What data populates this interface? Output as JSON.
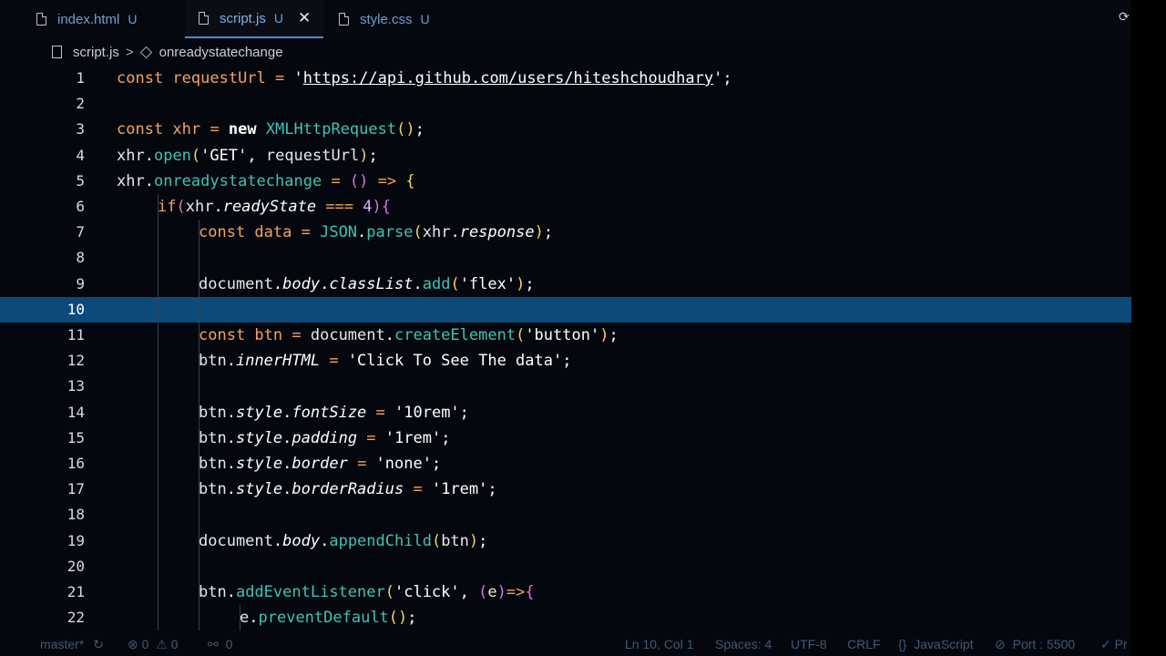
{
  "tabs": [
    {
      "label": "index.html",
      "status": "U",
      "active": false
    },
    {
      "label": "script.js",
      "status": "U",
      "active": true,
      "close": "✕"
    },
    {
      "label": "style.css",
      "status": "U",
      "active": false
    }
  ],
  "breadcrumb": {
    "file": "script.js",
    "separator": ">",
    "symbol": "onreadystatechange"
  },
  "editor": {
    "current_line": 10,
    "lines": [
      {
        "n": "1",
        "tokens": [
          [
            "kw",
            "const "
          ],
          [
            "var",
            "requestUrl"
          ],
          [
            "op",
            " = "
          ],
          [
            "str",
            "'"
          ],
          [
            "url",
            "https://api.github.com/users/hiteshchoudhary"
          ],
          [
            "str",
            "'"
          ],
          [
            "pn",
            ";"
          ]
        ]
      },
      {
        "n": "2",
        "tokens": []
      },
      {
        "n": "3",
        "tokens": [
          [
            "kw",
            "const "
          ],
          [
            "var",
            "xhr"
          ],
          [
            "op",
            " = "
          ],
          [
            "kw2",
            "new "
          ],
          [
            "cls",
            "XMLHttpRequest"
          ],
          [
            "par",
            "()"
          ],
          [
            "pn",
            ";"
          ]
        ]
      },
      {
        "n": "4",
        "tokens": [
          [
            "obj",
            "xhr"
          ],
          [
            "pn",
            "."
          ],
          [
            "fn",
            "open"
          ],
          [
            "par",
            "("
          ],
          [
            "str",
            "'GET'"
          ],
          [
            "pn",
            ", "
          ],
          [
            "obj",
            "requestUrl"
          ],
          [
            "par",
            ")"
          ],
          [
            "pn",
            ";"
          ]
        ]
      },
      {
        "n": "5",
        "tokens": [
          [
            "obj",
            "xhr"
          ],
          [
            "pn",
            "."
          ],
          [
            "fn",
            "onreadystatechange"
          ],
          [
            "op",
            " = "
          ],
          [
            "par2",
            "() "
          ],
          [
            "op",
            "=> "
          ],
          [
            "par",
            "{"
          ]
        ]
      },
      {
        "n": "6",
        "tokens": [
          [
            "kw",
            "if"
          ],
          [
            "par2",
            "("
          ],
          [
            "obj",
            "xhr"
          ],
          [
            "pn",
            "."
          ],
          [
            "prop",
            "readyState"
          ],
          [
            "op",
            " === "
          ],
          [
            "num",
            "4"
          ],
          [
            "par2",
            ")"
          ],
          [
            "par2",
            "{"
          ]
        ]
      },
      {
        "n": "7",
        "tokens": [
          [
            "kw",
            "const "
          ],
          [
            "var",
            "data"
          ],
          [
            "op",
            " = "
          ],
          [
            "cls",
            "JSON"
          ],
          [
            "pn",
            "."
          ],
          [
            "fn",
            "parse"
          ],
          [
            "par",
            "("
          ],
          [
            "obj",
            "xhr"
          ],
          [
            "pn",
            "."
          ],
          [
            "prop",
            "response"
          ],
          [
            "par",
            ")"
          ],
          [
            "pn",
            ";"
          ]
        ]
      },
      {
        "n": "8",
        "tokens": []
      },
      {
        "n": "9",
        "tokens": [
          [
            "obj",
            "document"
          ],
          [
            "pn",
            "."
          ],
          [
            "prop",
            "body"
          ],
          [
            "pn",
            "."
          ],
          [
            "prop",
            "classList"
          ],
          [
            "pn",
            "."
          ],
          [
            "fn",
            "add"
          ],
          [
            "par",
            "("
          ],
          [
            "str",
            "'flex'"
          ],
          [
            "par",
            ")"
          ],
          [
            "pn",
            ";"
          ]
        ]
      },
      {
        "n": "10",
        "tokens": []
      },
      {
        "n": "11",
        "tokens": [
          [
            "kw",
            "const "
          ],
          [
            "var",
            "btn"
          ],
          [
            "op",
            " = "
          ],
          [
            "obj",
            "document"
          ],
          [
            "pn",
            "."
          ],
          [
            "fn",
            "createElement"
          ],
          [
            "par",
            "("
          ],
          [
            "str",
            "'button'"
          ],
          [
            "par",
            ")"
          ],
          [
            "pn",
            ";"
          ]
        ]
      },
      {
        "n": "12",
        "tokens": [
          [
            "obj",
            "btn"
          ],
          [
            "pn",
            "."
          ],
          [
            "prop",
            "innerHTML"
          ],
          [
            "op",
            " = "
          ],
          [
            "str",
            "'Click To See The data'"
          ],
          [
            "pn",
            ";"
          ]
        ]
      },
      {
        "n": "13",
        "tokens": []
      },
      {
        "n": "14",
        "tokens": [
          [
            "obj",
            "btn"
          ],
          [
            "pn",
            "."
          ],
          [
            "prop",
            "style"
          ],
          [
            "pn",
            "."
          ],
          [
            "prop",
            "fontSize"
          ],
          [
            "op",
            " = "
          ],
          [
            "str",
            "'10rem'"
          ],
          [
            "pn",
            ";"
          ]
        ]
      },
      {
        "n": "15",
        "tokens": [
          [
            "obj",
            "btn"
          ],
          [
            "pn",
            "."
          ],
          [
            "prop",
            "style"
          ],
          [
            "pn",
            "."
          ],
          [
            "prop",
            "padding"
          ],
          [
            "op",
            " = "
          ],
          [
            "str",
            "'1rem'"
          ],
          [
            "pn",
            ";"
          ]
        ]
      },
      {
        "n": "16",
        "tokens": [
          [
            "obj",
            "btn"
          ],
          [
            "pn",
            "."
          ],
          [
            "prop",
            "style"
          ],
          [
            "pn",
            "."
          ],
          [
            "prop",
            "border"
          ],
          [
            "op",
            " = "
          ],
          [
            "str",
            "'none'"
          ],
          [
            "pn",
            ";"
          ]
        ]
      },
      {
        "n": "17",
        "tokens": [
          [
            "obj",
            "btn"
          ],
          [
            "pn",
            "."
          ],
          [
            "prop",
            "style"
          ],
          [
            "pn",
            "."
          ],
          [
            "prop",
            "borderRadius"
          ],
          [
            "op",
            " = "
          ],
          [
            "str",
            "'1rem'"
          ],
          [
            "pn",
            ";"
          ]
        ]
      },
      {
        "n": "18",
        "tokens": []
      },
      {
        "n": "19",
        "tokens": [
          [
            "obj",
            "document"
          ],
          [
            "pn",
            "."
          ],
          [
            "prop",
            "body"
          ],
          [
            "pn",
            "."
          ],
          [
            "fn",
            "appendChild"
          ],
          [
            "par",
            "("
          ],
          [
            "obj",
            "btn"
          ],
          [
            "par",
            ")"
          ],
          [
            "pn",
            ";"
          ]
        ]
      },
      {
        "n": "20",
        "tokens": []
      },
      {
        "n": "21",
        "tokens": [
          [
            "obj",
            "btn"
          ],
          [
            "pn",
            "."
          ],
          [
            "fn",
            "addEventListener"
          ],
          [
            "par",
            "("
          ],
          [
            "str",
            "'click'"
          ],
          [
            "pn",
            ", "
          ],
          [
            "par2",
            "("
          ],
          [
            "obj",
            "e"
          ],
          [
            "par2",
            ")"
          ],
          [
            "op",
            "=>"
          ],
          [
            "par2",
            "{"
          ]
        ]
      },
      {
        "n": "22",
        "tokens": [
          [
            "obj",
            "e"
          ],
          [
            "pn",
            "."
          ],
          [
            "fn",
            "preventDefault"
          ],
          [
            "par",
            "()"
          ],
          [
            "pn",
            ";"
          ]
        ]
      }
    ]
  },
  "statusbar": {
    "branch": "master*",
    "sync": "↻",
    "errors": "0",
    "warnings": "0",
    "ports": "0",
    "position": "Ln 10, Col 1",
    "spaces": "Spaces: 4",
    "encoding": "UTF-8",
    "eol": "CRLF",
    "language": "JavaScript",
    "port": "Port : 5500",
    "prettier": "Pr"
  },
  "colors": {
    "accent": "#4f89c6",
    "current_line": "#0c4a79",
    "keyword": "#f4a35d",
    "function": "#3fc3b5"
  }
}
